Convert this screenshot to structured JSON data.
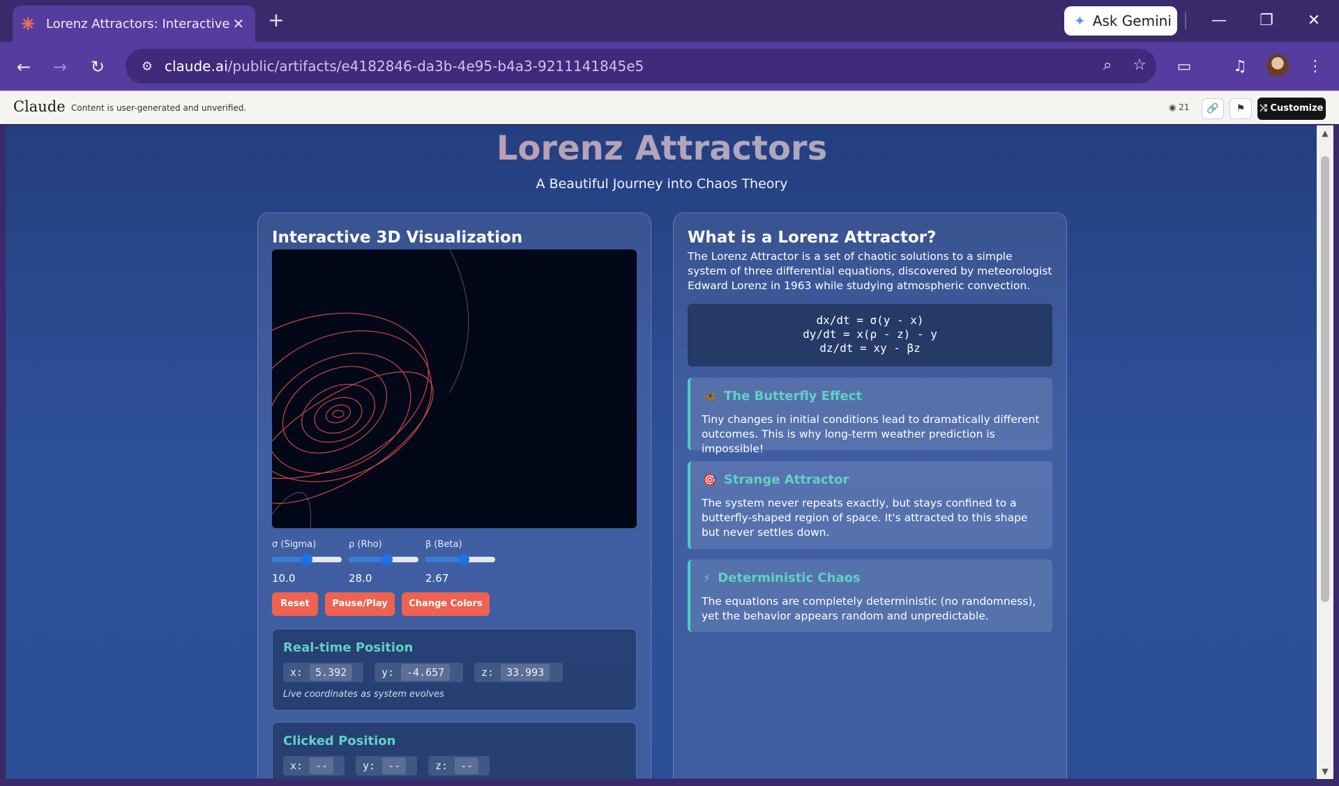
{
  "browser": {
    "tab_title": "Lorenz Attractors: Interactive Vi",
    "ask_gemini": "Ask Gemini",
    "url_host": "claude.ai",
    "url_path": "/public/artifacts/e4182846-da3b-4e95-b4a3-9211141845e5"
  },
  "claude_bar": {
    "logo": "Claude",
    "note": "Content is user-generated and unverified.",
    "views": "21",
    "customize": "Customize"
  },
  "page": {
    "title": "Lorenz Attractors",
    "subtitle": "A Beautiful Journey into Chaos Theory"
  },
  "viz": {
    "heading": "Interactive 3D Visualization",
    "stroke_color": "#e0504a",
    "sliders": [
      {
        "label": "σ (Sigma)",
        "value": "10.0",
        "fraction": 0.5
      },
      {
        "label": "ρ (Rho)",
        "value": "28.0",
        "fraction": 0.55
      },
      {
        "label": "β (Beta)",
        "value": "2.67",
        "fraction": 0.55
      }
    ],
    "buttons": {
      "reset": "Reset",
      "pause": "Pause/Play",
      "colors": "Change Colors"
    },
    "realtime": {
      "title": "Real-time Position",
      "x_label": "x:",
      "x": "5.392",
      "y_label": "y:",
      "y": "-4.657",
      "z_label": "z:",
      "z": "33.993",
      "note": "Live coordinates as system evolves"
    },
    "clicked": {
      "title": "Clicked Position",
      "x_label": "x:",
      "x": "--",
      "y_label": "y:",
      "y": "--",
      "z_label": "z:",
      "z": "--"
    }
  },
  "info": {
    "heading": "What is a Lorenz Attractor?",
    "intro": "The Lorenz Attractor is a set of chaotic solutions to a simple system of three differential equations, discovered by meteorologist Edward Lorenz in 1963 while studying atmospheric convection.",
    "equations": [
      "dx/dt = σ(y - x)",
      "dy/dt = x(ρ - z) - y",
      "dz/dt = xy - βz"
    ],
    "cards": [
      {
        "icon": "🦋",
        "title": "The Butterfly Effect",
        "text": "Tiny changes in initial conditions lead to dramatically different outcomes. This is why long-term weather prediction is impossible!"
      },
      {
        "icon": "🎯",
        "title": "Strange Attractor",
        "text": "The system never repeats exactly, but stays confined to a butterfly-shaped region of space. It's attracted to this shape but never settles down."
      },
      {
        "icon": "⚡",
        "title": "Deterministic Chaos",
        "text": "The equations are completely deterministic (no randomness), yet the behavior appears random and unpredictable."
      }
    ]
  }
}
